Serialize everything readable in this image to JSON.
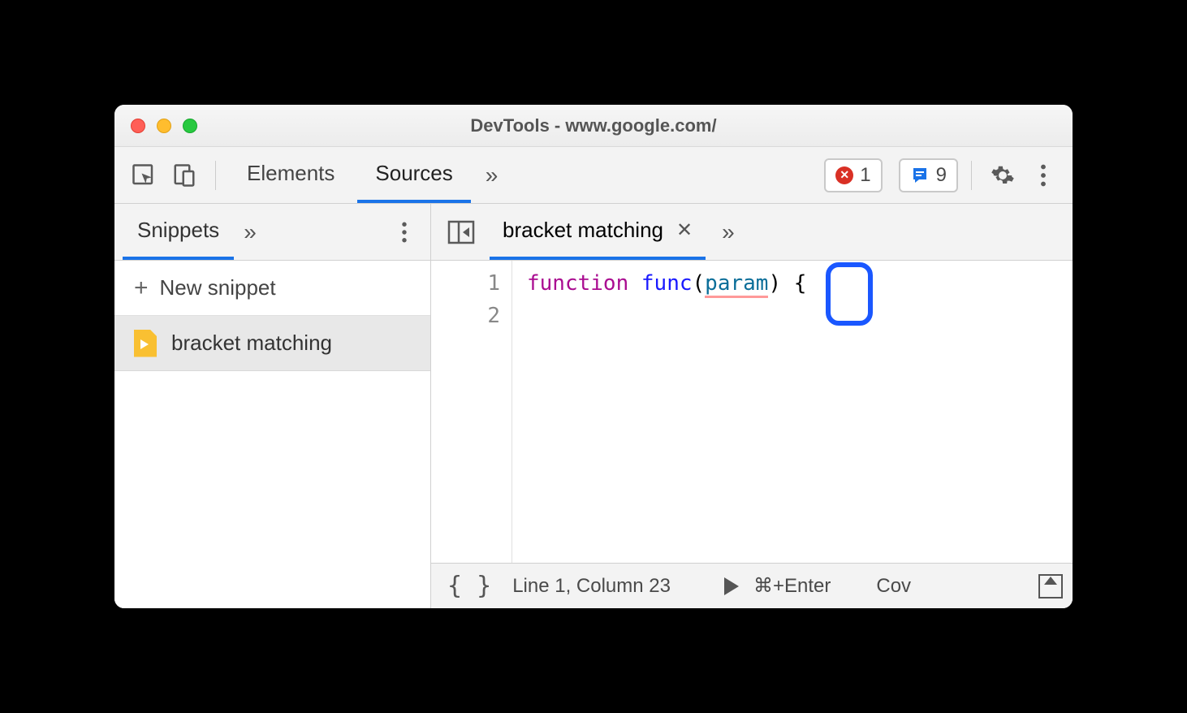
{
  "window": {
    "title": "DevTools - www.google.com/"
  },
  "toolbar": {
    "tabs": {
      "elements": "Elements",
      "sources": "Sources"
    },
    "error_count": "1",
    "issue_count": "9"
  },
  "sidebar": {
    "tab_label": "Snippets",
    "new_snippet_label": "New snippet",
    "items": [
      {
        "label": "bracket matching"
      }
    ]
  },
  "editor": {
    "tab_label": "bracket matching",
    "lines": [
      "1",
      "2"
    ],
    "code": {
      "keyword": "function",
      "name": "func",
      "open_paren": "(",
      "param": "param",
      "close_paren": ")",
      "brace": "{"
    }
  },
  "status": {
    "position": "Line 1, Column 23",
    "run_label": "⌘+Enter",
    "coverage_label": "Cov"
  }
}
